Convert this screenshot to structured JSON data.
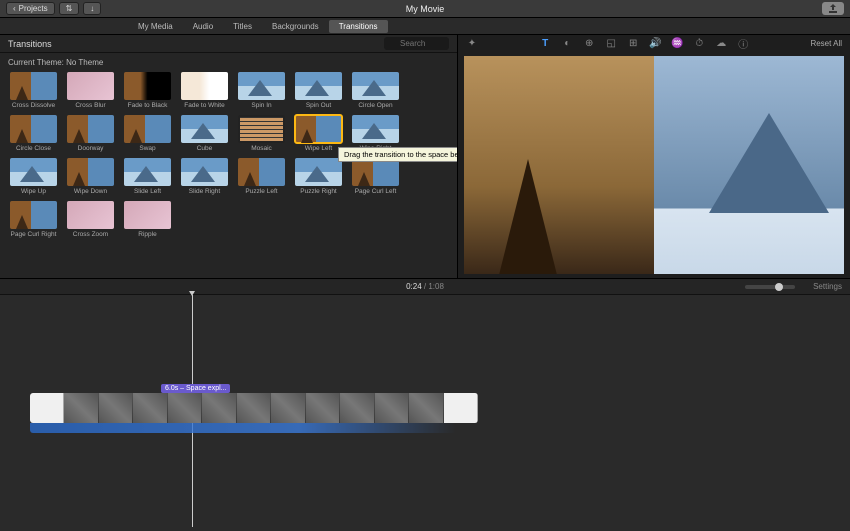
{
  "titlebar": {
    "back_label": "Projects",
    "title": "My Movie"
  },
  "tabs": [
    {
      "label": "My Media",
      "active": false
    },
    {
      "label": "Audio",
      "active": false
    },
    {
      "label": "Titles",
      "active": false
    },
    {
      "label": "Backgrounds",
      "active": false
    },
    {
      "label": "Transitions",
      "active": true
    }
  ],
  "browser": {
    "title": "Transitions",
    "search_placeholder": "Search",
    "theme_label": "Current Theme: No Theme",
    "tooltip": "Drag the transition to the space before or after a clip"
  },
  "transitions": [
    {
      "label": "Cross Dissolve"
    },
    {
      "label": "Cross Blur"
    },
    {
      "label": "Fade to Black"
    },
    {
      "label": "Fade to White"
    },
    {
      "label": "Spin In"
    },
    {
      "label": "Spin Out"
    },
    {
      "label": "Circle Open"
    },
    {
      "label": "Circle Close"
    },
    {
      "label": "Doorway"
    },
    {
      "label": "Swap"
    },
    {
      "label": "Cube"
    },
    {
      "label": "Mosaic"
    },
    {
      "label": "Wipe Left",
      "highlight": true
    },
    {
      "label": "Wipe Right"
    },
    {
      "label": "Wipe Up"
    },
    {
      "label": "Wipe Down"
    },
    {
      "label": "Slide Left"
    },
    {
      "label": "Slide Right"
    },
    {
      "label": "Puzzle Left"
    },
    {
      "label": "Puzzle Right"
    },
    {
      "label": "Page Curl Left"
    },
    {
      "label": "Page Curl Right"
    },
    {
      "label": "Cross Zoom"
    },
    {
      "label": "Ripple"
    }
  ],
  "viewer_toolbar": {
    "reset_label": "Reset All"
  },
  "timeline": {
    "current_time": "0:24",
    "total_time": "1:08",
    "settings_label": "Settings",
    "clip_badge": "6.0s – Space expl..."
  }
}
